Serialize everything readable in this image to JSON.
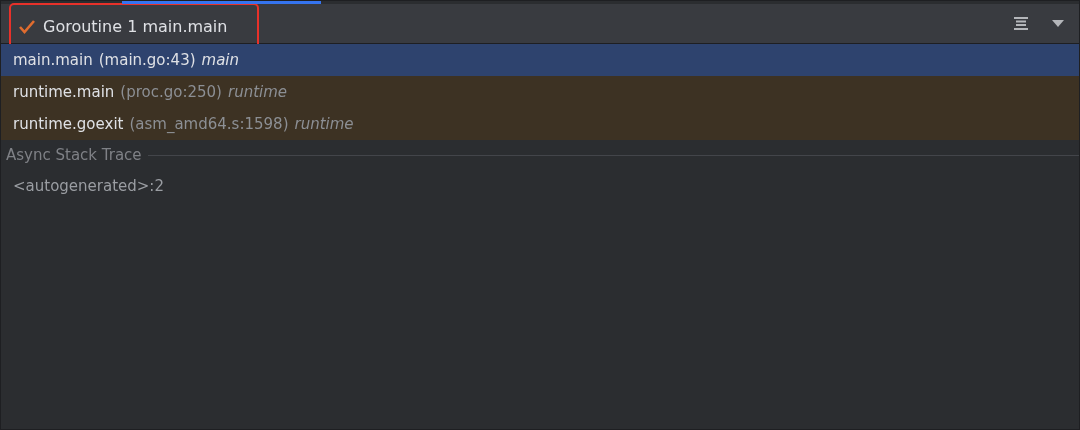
{
  "goroutine_selector": {
    "label": "Goroutine 1 main.main",
    "checked": true
  },
  "frames": [
    {
      "function": "main.main",
      "location": "(main.go:43)",
      "package": "main",
      "selected": true,
      "kind": "user"
    },
    {
      "function": "runtime.main",
      "location": "(proc.go:250)",
      "package": "runtime",
      "selected": false,
      "kind": "library"
    },
    {
      "function": "runtime.goexit",
      "location": "(asm_amd64.s:1598)",
      "package": "runtime",
      "selected": false,
      "kind": "library"
    }
  ],
  "async_section": {
    "title": "Async Stack Trace",
    "items": [
      "<autogenerated>:2"
    ]
  }
}
